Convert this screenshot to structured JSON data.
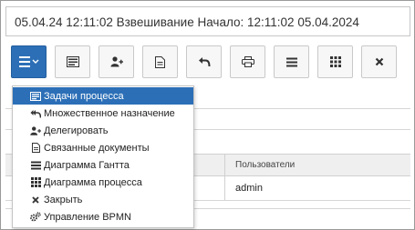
{
  "header": {
    "title": "05.04.24 12:11:02 Взвешивание Начало: 12:11:02 05.04.2024"
  },
  "toolbar": {
    "buttons": [
      {
        "icon": "menu-icon",
        "has_dropdown": true
      },
      {
        "icon": "task-list-icon"
      },
      {
        "icon": "add-user-icon"
      },
      {
        "icon": "document-icon"
      },
      {
        "icon": "undo-icon"
      },
      {
        "icon": "print-icon"
      },
      {
        "icon": "menu-icon"
      },
      {
        "icon": "grid-icon"
      },
      {
        "icon": "close-icon"
      }
    ]
  },
  "dropdown": {
    "items": [
      {
        "label": "Задачи процесса",
        "icon": "task-list-icon",
        "active": true
      },
      {
        "label": "Множественное назначение",
        "icon": "reply-all-icon"
      },
      {
        "label": "Делегировать",
        "icon": "add-user-icon"
      },
      {
        "label": "Связанные документы",
        "icon": "document-icon"
      },
      {
        "label": "Диаграмма Гантта",
        "icon": "gantt-icon"
      },
      {
        "label": "Диаграмма процесса",
        "icon": "grid-icon"
      },
      {
        "label": "Закрыть",
        "icon": "close-icon"
      },
      {
        "label": "Управление BPMN",
        "icon": "gears-icon"
      }
    ]
  },
  "table": {
    "columns": [
      "Пользователи"
    ],
    "rows": [
      [
        "admin"
      ]
    ]
  },
  "colors": {
    "accent": "#2c6fb7",
    "button_bg": "#f7f7f7",
    "border": "#c9c9c9"
  }
}
